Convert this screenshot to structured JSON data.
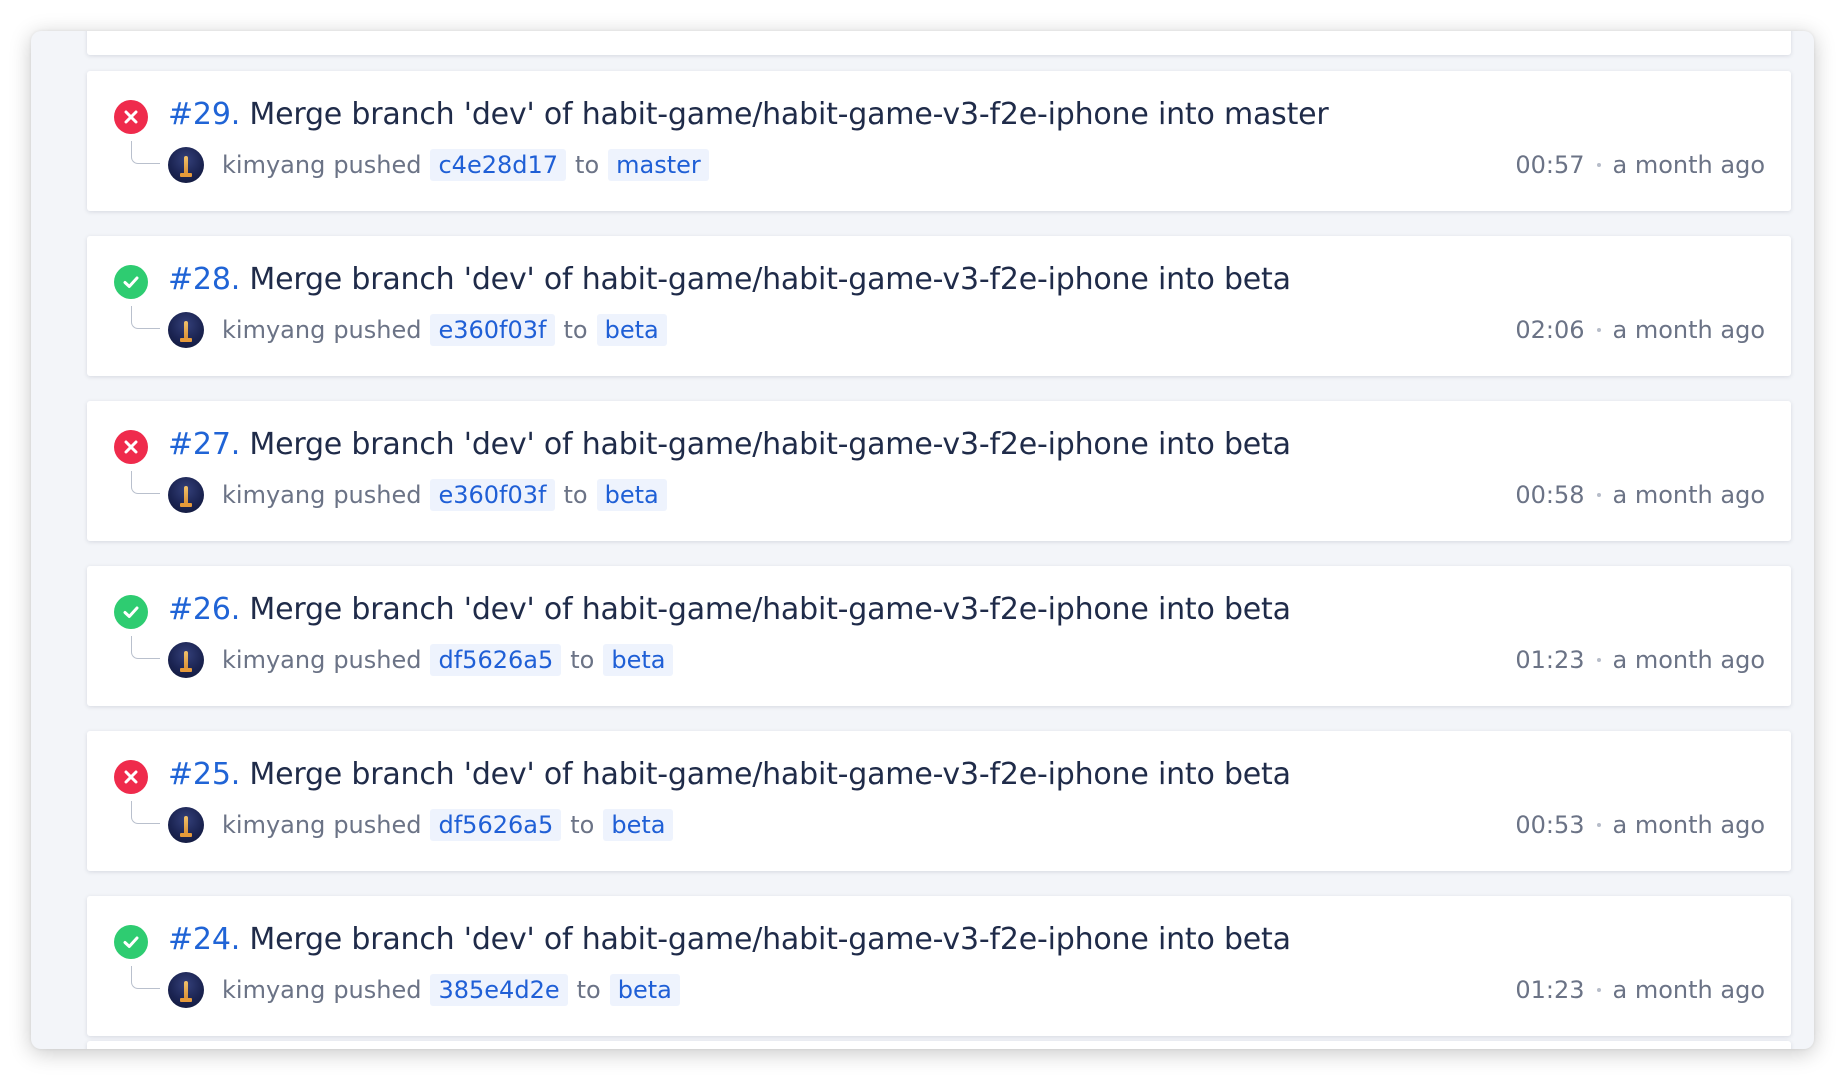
{
  "builds": [
    {
      "number": "#29.",
      "status": "failed",
      "title": "Merge branch 'dev' of habit-game/habit-game-v3-f2e-iphone into master",
      "user": "kimyang",
      "action": "pushed",
      "commit": "c4e28d17",
      "to_word": "to",
      "branch": "master",
      "duration": "00:57",
      "relative_time": "a month ago"
    },
    {
      "number": "#28.",
      "status": "success",
      "title": "Merge branch 'dev' of habit-game/habit-game-v3-f2e-iphone into beta",
      "user": "kimyang",
      "action": "pushed",
      "commit": "e360f03f",
      "to_word": "to",
      "branch": "beta",
      "duration": "02:06",
      "relative_time": "a month ago"
    },
    {
      "number": "#27.",
      "status": "failed",
      "title": "Merge branch 'dev' of habit-game/habit-game-v3-f2e-iphone into beta",
      "user": "kimyang",
      "action": "pushed",
      "commit": "e360f03f",
      "to_word": "to",
      "branch": "beta",
      "duration": "00:58",
      "relative_time": "a month ago"
    },
    {
      "number": "#26.",
      "status": "success",
      "title": "Merge branch 'dev' of habit-game/habit-game-v3-f2e-iphone into beta",
      "user": "kimyang",
      "action": "pushed",
      "commit": "df5626a5",
      "to_word": "to",
      "branch": "beta",
      "duration": "01:23",
      "relative_time": "a month ago"
    },
    {
      "number": "#25.",
      "status": "failed",
      "title": "Merge branch 'dev' of habit-game/habit-game-v3-f2e-iphone into beta",
      "user": "kimyang",
      "action": "pushed",
      "commit": "df5626a5",
      "to_word": "to",
      "branch": "beta",
      "duration": "00:53",
      "relative_time": "a month ago"
    },
    {
      "number": "#24.",
      "status": "success",
      "title": "Merge branch 'dev' of habit-game/habit-game-v3-f2e-iphone into beta",
      "user": "kimyang",
      "action": "pushed",
      "commit": "385e4d2e",
      "to_word": "to",
      "branch": "beta",
      "duration": "01:23",
      "relative_time": "a month ago"
    }
  ],
  "icons": {
    "failed": "close-circle-icon",
    "success": "check-circle-icon"
  },
  "colors": {
    "failed": "#ef2b4c",
    "success": "#2ecc71",
    "link": "#2064d6",
    "chip_bg": "#eef3fd",
    "title_text": "#1f2b49",
    "muted_text": "#6b7386",
    "background": "#f3f5f9"
  }
}
